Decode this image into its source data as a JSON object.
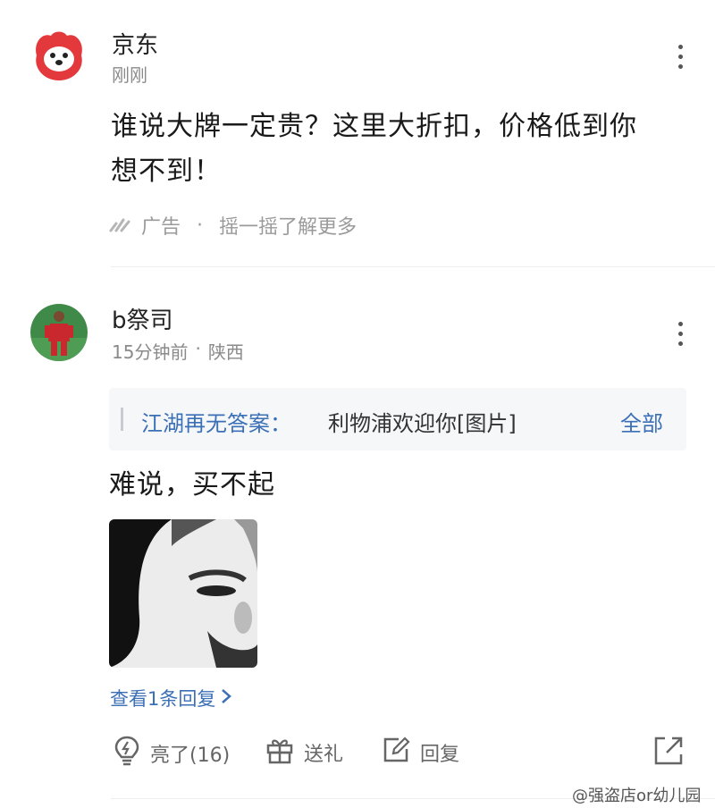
{
  "ad_post": {
    "author": "京东",
    "time": "刚刚",
    "text_line1": "谁说大牌一定贵？这里大折扣，价格低到你",
    "text_line2": "想不到！",
    "ad_label": "广告",
    "separator": "·",
    "ad_action": "摇一摇了解更多"
  },
  "comment": {
    "author": "b祭司",
    "time": "15分钟前",
    "separator": "·",
    "location": "陕西",
    "quote_user": "江湖再无答案：",
    "quote_text": "利物浦欢迎你[图片]",
    "quote_all": "全部",
    "text": "难说，买不起",
    "view_replies": "查看1条回复",
    "actions": {
      "like": "亮了(16)",
      "gift": "送礼",
      "reply": "回复"
    }
  },
  "watermark": "@强盗店or幼儿园",
  "colors": {
    "link": "#3b6fb6",
    "jd_red": "#e4393c",
    "muted": "#8a8a8a"
  }
}
